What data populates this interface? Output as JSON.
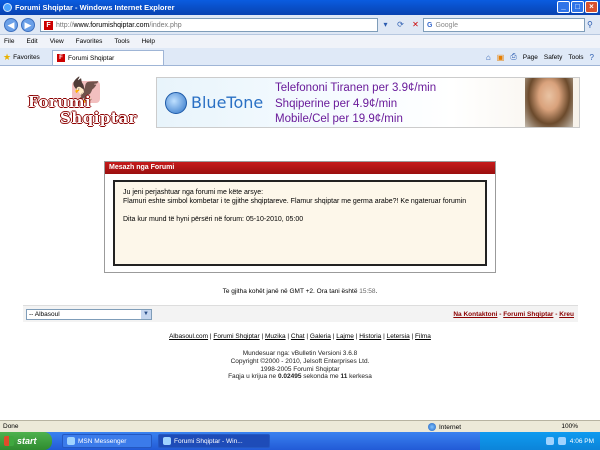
{
  "window": {
    "title": "Forumi Shqiptar - Windows Internet Explorer"
  },
  "address": {
    "url_scheme": "http://",
    "url_host": "www.forumishqiptar.com",
    "url_path": "/index.php",
    "search_placeholder": "Google"
  },
  "menu": [
    "File",
    "Edit",
    "View",
    "Favorites",
    "Tools",
    "Help"
  ],
  "favorites_label": "Favorites",
  "tab_title": "Forumi Shqiptar",
  "commandbar": {
    "page": "Page",
    "safety": "Safety",
    "tools": "Tools"
  },
  "logo": {
    "line1": "Forumi",
    "line2": "Shqiptar"
  },
  "banner": {
    "brand": "BlueTone",
    "line1": "Telefononi Tiranen  per 3.9¢/min",
    "line2": "Shqiperine per 4.9¢/min",
    "line3": "Mobile/Cel per 19.9¢/min"
  },
  "message": {
    "header": "Mesazh nga Forumi",
    "intro": "Ju jeni perjashtuar nga forumi me këte arsye:",
    "reason": "Flamuri eshte simbol kombetar i te gjithe shqiptareve. Flamur shqiptar me germa arabe?! Ke ngateruar forumin",
    "ban_end": "Dita kur mund të hyni përsëri në forum: 05-10-2010, 05:00"
  },
  "timezone": {
    "text": "Te gjitha kohët janë në GMT +2. Ora tani është ",
    "time": "15:58",
    "end": "."
  },
  "footer": {
    "style_select": "-- Albasoul",
    "links": [
      "Na Kontaktoni",
      "Forumi Shqiptar",
      "Kreu"
    ],
    "sitelinks": [
      "Albasoul.com",
      "Forumi Shqiptar",
      "Muzika",
      "Chat",
      "Galeria",
      "Lajme",
      "Historia",
      "Letersia",
      "Filma"
    ]
  },
  "credits": {
    "line1": "Mundesuar nga: vBulletin Versioni 3.6.8",
    "line2": "Copyright ©2000 - 2010, Jelsoft Enterprises Ltd.",
    "line3": "1998-2005 Forumi Shqiptar",
    "line4_a": "Faqja u krijua ne ",
    "line4_b": "0.02495",
    "line4_c": " sekonda me ",
    "line4_d": "11",
    "line4_e": " kerkesa"
  },
  "status": {
    "left": "Done",
    "zone": "Internet",
    "zoom": "100%"
  },
  "taskbar": {
    "start": "start",
    "tasks": [
      "MSN Messenger",
      "Forumi Shqiptar - Win..."
    ],
    "clock": "4:06 PM"
  }
}
